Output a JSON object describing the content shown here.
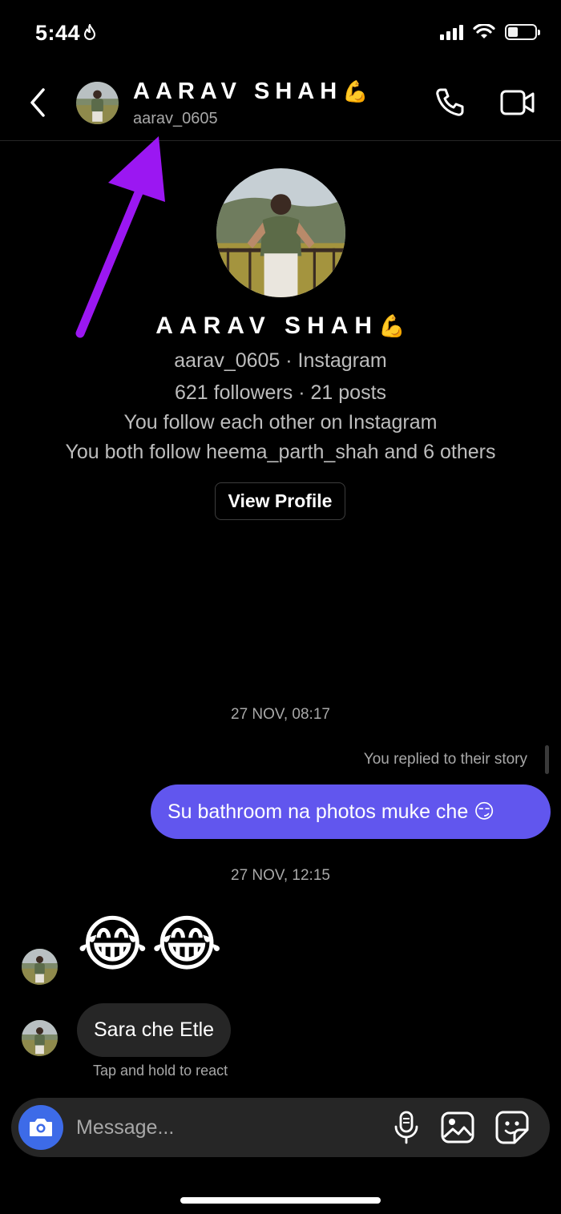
{
  "status_bar": {
    "time": "5:44",
    "focus_glyph": "🔥"
  },
  "header": {
    "name": "AARAV SHAH",
    "name_emoji": "💪",
    "username": "aarav_0605"
  },
  "profile": {
    "name": "AARAV SHAH",
    "name_emoji": "💪",
    "line1": "aarav_0605 · Instagram",
    "line2": "621 followers · 21 posts",
    "line3": "You follow each other on Instagram",
    "line4": "You both follow heema_parth_shah and 6 others",
    "view_profile_label": "View Profile"
  },
  "messages": {
    "timestamp1": "27 NOV, 08:17",
    "replied_label": "You replied to their story",
    "sent_text": "Su bathroom na photos muke che 😏",
    "timestamp2": "27 NOV, 12:15",
    "received_emoji": "😂😂",
    "received_text": "Sara che Etle",
    "react_hint": "Tap and hold to react"
  },
  "composer": {
    "placeholder": "Message..."
  },
  "colors": {
    "background": "#000000",
    "sent_bubble": "#6156ee",
    "received_bubble": "#262626",
    "camera_button": "#3d6be8",
    "annotation_arrow": "#9b17f2",
    "secondary_text": "#a8a8a8"
  },
  "icons": [
    "back-chevron-icon",
    "phone-icon",
    "video-camera-icon",
    "camera-icon",
    "microphone-icon",
    "gallery-icon",
    "sticker-icon",
    "wifi-icon",
    "signal-icon",
    "battery-icon"
  ]
}
